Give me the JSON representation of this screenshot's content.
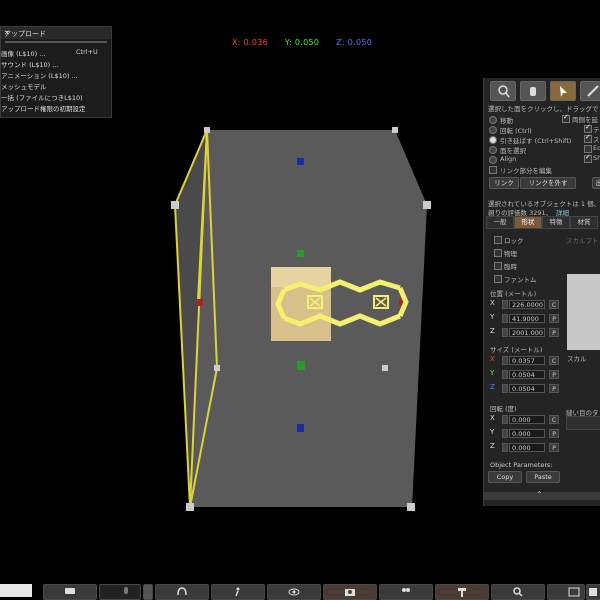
{
  "coords": {
    "x": "X: 0.036",
    "y": "Y: 0.050",
    "z": "Z: 0.050",
    "x_color": "#ff4040",
    "y_color": "#40ff40",
    "z_color": "#5080ff"
  },
  "upload_menu": {
    "title": "アップロード",
    "items": [
      {
        "label": "画像 (L$10) ...",
        "shortcut": "Ctrl+U"
      },
      {
        "label": "サウンド (L$10) ...",
        "shortcut": ""
      },
      {
        "label": "アニメーション (L$10) ...",
        "shortcut": ""
      },
      {
        "label": "メッシュモデル",
        "shortcut": ""
      },
      {
        "label": "一括 (ファイルにつきL$10)",
        "shortcut": ""
      },
      {
        "label": "アップロード権限の初期設定",
        "shortcut": ""
      }
    ]
  },
  "build_panel": {
    "hint": "選択した面をクリックし、ドラッグで",
    "modes": [
      "移動",
      "回転 (Ctrl)",
      "引き延ばす (Ctrl+Shift)",
      "面を選択",
      "Align",
      "リンク部分を編集"
    ],
    "checks": [
      "両側を延",
      "テク",
      "スク",
      "Ed",
      "Sh"
    ],
    "link_btn": "リンク",
    "unlink_btn": "リンクを外す",
    "extra_btn": "出",
    "selected_info": "選択されているオブジェクトは 1 個、",
    "land_impact": "親りの評価数 3291、",
    "land_link": "詳細",
    "tabs": [
      "一般",
      "形状",
      "特徴",
      "材質"
    ],
    "flags": [
      "ロック",
      "物理",
      "臨時",
      "ファントム"
    ],
    "sculpt_label": "スカルプト",
    "position_label": "位置 (メートル)",
    "position": {
      "x": "226.0000",
      "y": "41.9000",
      "z": "2001.000"
    },
    "size_label": "サイズ (メートル)",
    "size": {
      "x": "0.0357",
      "y": "0.0504",
      "z": "0.0504"
    },
    "rotation_label": "回転 (度)",
    "rotation": {
      "x": "0.000",
      "y": "0.000",
      "z": "0.000"
    },
    "sculpt_label2": "スカル",
    "tex_label": "縫い目のタ",
    "params_label": "Object Parameters:",
    "copy": "Copy",
    "paste": "Paste",
    "c": "C",
    "p": "P",
    "ax_x": "X",
    "ax_y": "Y",
    "ax_z": "Z"
  },
  "bottom_bar": {
    "buttons": [
      "chat-icon",
      "voice-icon",
      "headphones-icon",
      "walk-icon",
      "eye-icon",
      "camera-icon",
      "people-icon",
      "build-icon",
      "search-icon",
      "map-icon",
      "minimap-icon"
    ]
  }
}
